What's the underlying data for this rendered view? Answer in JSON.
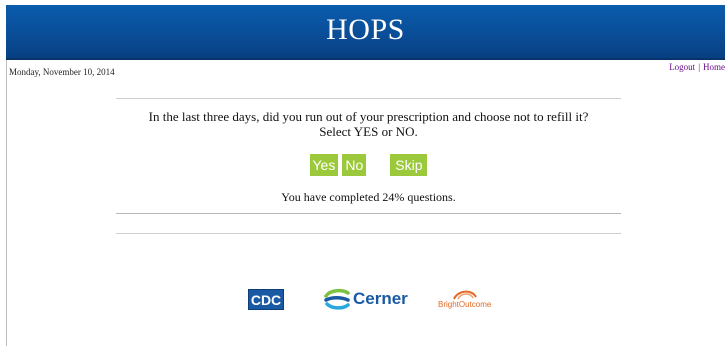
{
  "header": {
    "title": "HOPS"
  },
  "date": "Monday, November 10, 2014",
  "nav": {
    "logout": "Logout",
    "separator": "|",
    "home": "Home"
  },
  "question": {
    "line1": "In the last three days, did you run out of your prescription and choose not to refill it?",
    "line2": "Select YES or NO."
  },
  "answers": {
    "yes": "Yes",
    "no": "No",
    "skip": "Skip"
  },
  "progress": {
    "text": "You have completed 24% questions.",
    "percent": 24
  },
  "logos": {
    "cdc": "CDC",
    "cerner": "Cerner",
    "brightoutcome": "BrightOutcome"
  },
  "colors": {
    "header": "#0a4d97",
    "button": "#9cc93b",
    "link": "#6b0d8b"
  }
}
